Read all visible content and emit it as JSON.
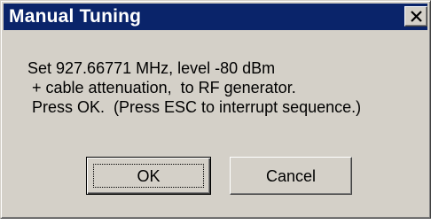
{
  "window": {
    "title": "Manual Tuning"
  },
  "message": {
    "lines": [
      "Set 927.66771 MHz, level -80 dBm",
      " + cable attenuation,  to RF generator.",
      " Press OK.  (Press ESC to interrupt sequence.)"
    ]
  },
  "buttons": {
    "ok_label": "OK",
    "cancel_label": "Cancel"
  },
  "icons": {
    "close": "close-icon"
  },
  "colors": {
    "titlebar": "#0a246a",
    "dialog_face": "#d4d0c8"
  }
}
